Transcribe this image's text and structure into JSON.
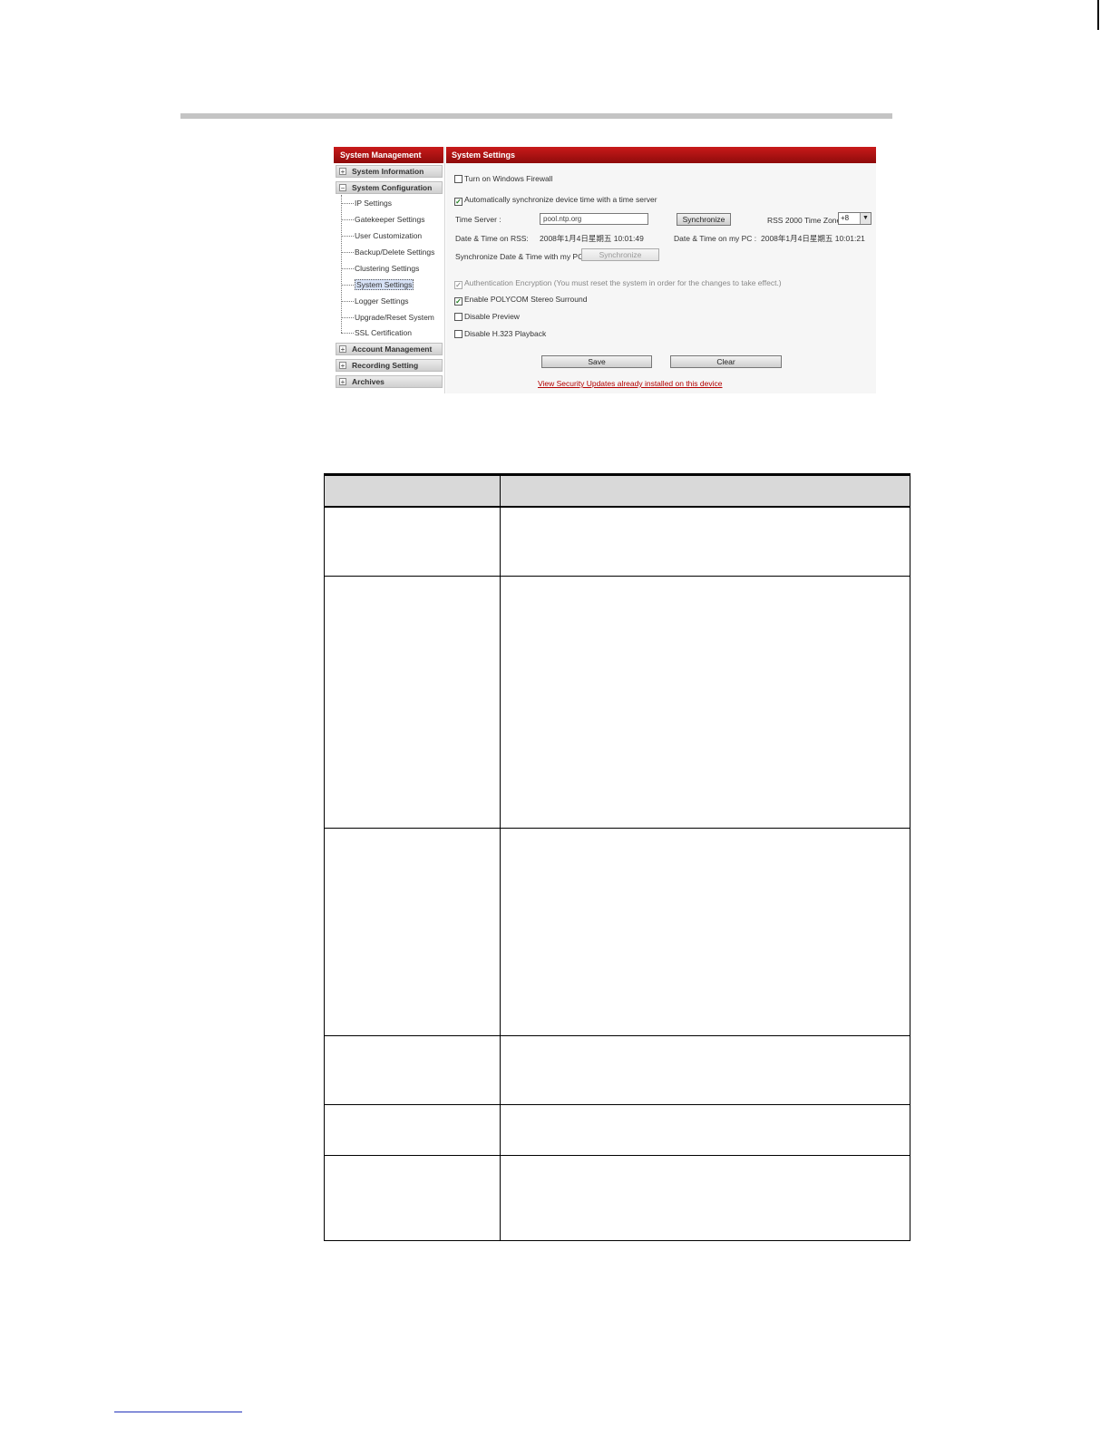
{
  "sidebar": {
    "header": "System Management",
    "sections": [
      {
        "label": "System Information",
        "expand": "+"
      },
      {
        "label": "System Configuration",
        "expand": "−"
      },
      {
        "label": "Account Management",
        "expand": "+"
      },
      {
        "label": "Recording Setting",
        "expand": "+"
      },
      {
        "label": "Archives",
        "expand": "+"
      }
    ],
    "items": [
      "IP Settings",
      "Gatekeeper Settings",
      "User Customization",
      "Backup/Delete Settings",
      "Clustering Settings",
      "System Settings",
      "Logger Settings",
      "Upgrade/Reset System",
      "SSL Certification"
    ]
  },
  "content": {
    "header": "System Settings",
    "firewall_label": "Turn on Windows Firewall",
    "firewall_checked": false,
    "auto_sync_label": "Automatically synchronize device time with a time server",
    "auto_sync_checked": true,
    "time_server_label": "Time Server :",
    "time_server_value": "pool.ntp.org",
    "synchronize_label": "Synchronize",
    "timezone_label": "RSS 2000 Time Zone",
    "timezone_value": "+8",
    "date_rss_label": "Date & Time on RSS:",
    "date_rss_value": "2008年1月4日星期五 10:01:49",
    "date_pc_label": "Date & Time on my PC :",
    "date_pc_value": "2008年1月4日星期五 10:01:21",
    "sync_pc_label": "Synchronize Date & Time with my PC",
    "sync_pc_button": "Synchronize",
    "auth_label": "Authentication Encryption (You must reset the system in order for the changes to take effect.)",
    "stereo_label": "Enable POLYCOM Stereo Surround",
    "stereo_checked": true,
    "preview_label": "Disable Preview",
    "preview_checked": false,
    "playback_label": "Disable H.323 Playback",
    "playback_checked": false,
    "save_label": "Save",
    "clear_label": "Clear",
    "security_link": "View Security Updates already installed on this device"
  },
  "icons": {
    "check": "check-mark-icon",
    "expand": "plus-icon",
    "collapse": "minus-icon",
    "dropdown": "chevron-down-icon"
  }
}
